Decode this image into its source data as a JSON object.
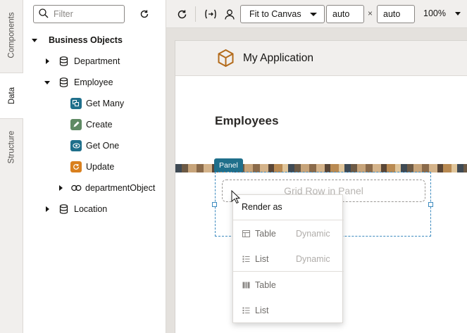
{
  "rail": {
    "tabs": [
      {
        "label": "Components"
      },
      {
        "label": "Data"
      },
      {
        "label": "Structure"
      }
    ]
  },
  "data_panel": {
    "filter_placeholder": "Filter",
    "tree": {
      "root": "Business Objects",
      "items": [
        {
          "label": "Department"
        },
        {
          "label": "Employee"
        },
        {
          "label": "Get Many"
        },
        {
          "label": "Create"
        },
        {
          "label": "Get One"
        },
        {
          "label": "Update"
        },
        {
          "label": "departmentObject"
        },
        {
          "label": "Location"
        }
      ]
    }
  },
  "toolbar": {
    "fit_select": "Fit to Canvas",
    "width_value": "auto",
    "height_value": "auto",
    "times": "×",
    "zoom": "100%"
  },
  "canvas": {
    "app_title": "My Application",
    "page_title": "Employees",
    "panel_tag": "Panel",
    "grid_row_placeholder": "Grid Row in Panel"
  },
  "menu": {
    "heading": "Render as",
    "items": [
      {
        "label": "Table",
        "tag": "Dynamic"
      },
      {
        "label": "List",
        "tag": "Dynamic"
      },
      {
        "label": "Table",
        "tag": ""
      },
      {
        "label": "List",
        "tag": ""
      }
    ]
  },
  "colors": {
    "accent": "#1f6f8b",
    "selection": "#3d8bbf",
    "logo": "#b36b1b"
  }
}
